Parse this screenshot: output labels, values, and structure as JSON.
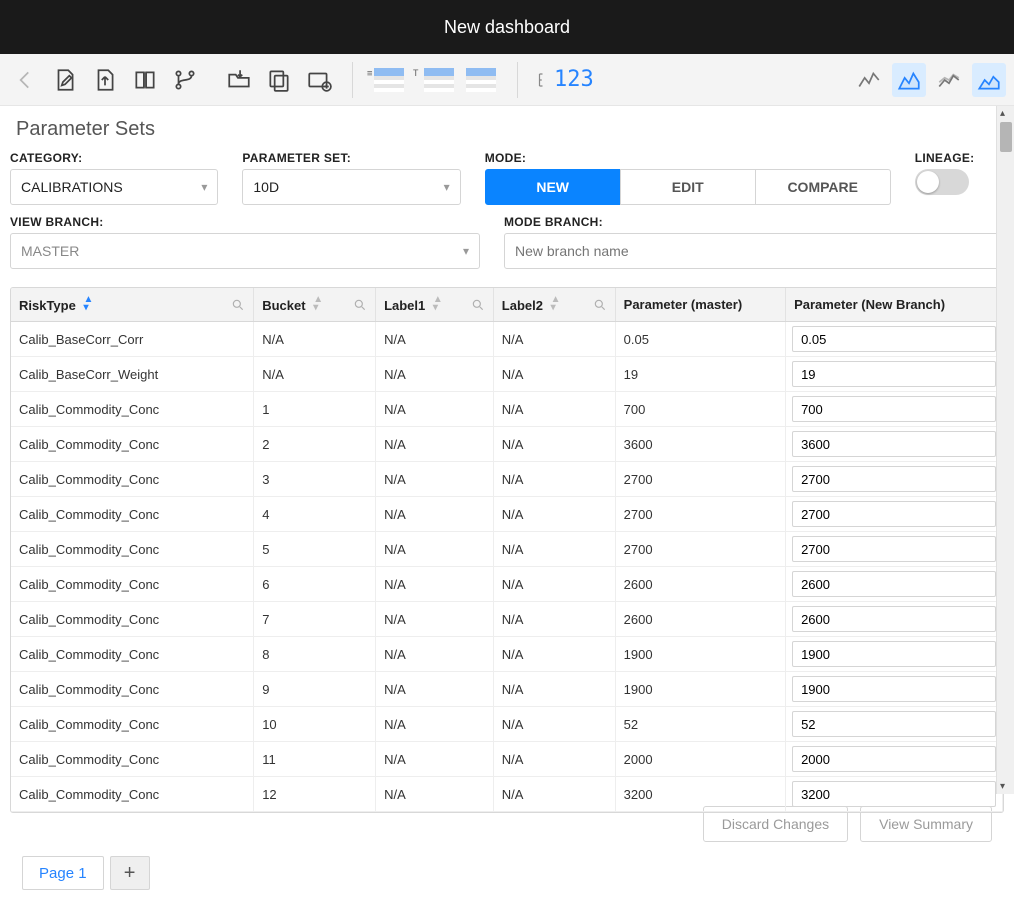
{
  "title": "New dashboard",
  "section_title": "Parameter Sets",
  "labels": {
    "category": "CATEGORY:",
    "parameter_set": "PARAMETER SET:",
    "mode": "MODE:",
    "lineage": "LINEAGE:",
    "view_branch": "VIEW BRANCH:",
    "mode_branch": "MODE BRANCH:"
  },
  "category_value": "CALIBRATIONS",
  "paramset_value": "10D",
  "view_branch_value": "MASTER",
  "mode_branch_placeholder": "New branch name",
  "modes": {
    "new": "NEW",
    "edit": "EDIT",
    "compare": "COMPARE"
  },
  "columns": {
    "risk": "RiskType",
    "bucket": "Bucket",
    "l1": "Label1",
    "l2": "Label2",
    "pm": "Parameter (master)",
    "pn": "Parameter (New Branch)"
  },
  "rows": [
    {
      "risk": "Calib_BaseCorr_Corr",
      "bucket": "N/A",
      "l1": "N/A",
      "l2": "N/A",
      "pm": "0.05",
      "pn": "0.05"
    },
    {
      "risk": "Calib_BaseCorr_Weight",
      "bucket": "N/A",
      "l1": "N/A",
      "l2": "N/A",
      "pm": "19",
      "pn": "19"
    },
    {
      "risk": "Calib_Commodity_Conc",
      "bucket": "1",
      "l1": "N/A",
      "l2": "N/A",
      "pm": "700",
      "pn": "700"
    },
    {
      "risk": "Calib_Commodity_Conc",
      "bucket": "2",
      "l1": "N/A",
      "l2": "N/A",
      "pm": "3600",
      "pn": "3600"
    },
    {
      "risk": "Calib_Commodity_Conc",
      "bucket": "3",
      "l1": "N/A",
      "l2": "N/A",
      "pm": "2700",
      "pn": "2700"
    },
    {
      "risk": "Calib_Commodity_Conc",
      "bucket": "4",
      "l1": "N/A",
      "l2": "N/A",
      "pm": "2700",
      "pn": "2700"
    },
    {
      "risk": "Calib_Commodity_Conc",
      "bucket": "5",
      "l1": "N/A",
      "l2": "N/A",
      "pm": "2700",
      "pn": "2700"
    },
    {
      "risk": "Calib_Commodity_Conc",
      "bucket": "6",
      "l1": "N/A",
      "l2": "N/A",
      "pm": "2600",
      "pn": "2600"
    },
    {
      "risk": "Calib_Commodity_Conc",
      "bucket": "7",
      "l1": "N/A",
      "l2": "N/A",
      "pm": "2600",
      "pn": "2600"
    },
    {
      "risk": "Calib_Commodity_Conc",
      "bucket": "8",
      "l1": "N/A",
      "l2": "N/A",
      "pm": "1900",
      "pn": "1900"
    },
    {
      "risk": "Calib_Commodity_Conc",
      "bucket": "9",
      "l1": "N/A",
      "l2": "N/A",
      "pm": "1900",
      "pn": "1900"
    },
    {
      "risk": "Calib_Commodity_Conc",
      "bucket": "10",
      "l1": "N/A",
      "l2": "N/A",
      "pm": "52",
      "pn": "52"
    },
    {
      "risk": "Calib_Commodity_Conc",
      "bucket": "11",
      "l1": "N/A",
      "l2": "N/A",
      "pm": "2000",
      "pn": "2000"
    },
    {
      "risk": "Calib_Commodity_Conc",
      "bucket": "12",
      "l1": "N/A",
      "l2": "N/A",
      "pm": "3200",
      "pn": "3200"
    }
  ],
  "buttons": {
    "discard": "Discard Changes",
    "summary": "View Summary"
  },
  "pagetab": "Page 1",
  "num_icon": "123"
}
